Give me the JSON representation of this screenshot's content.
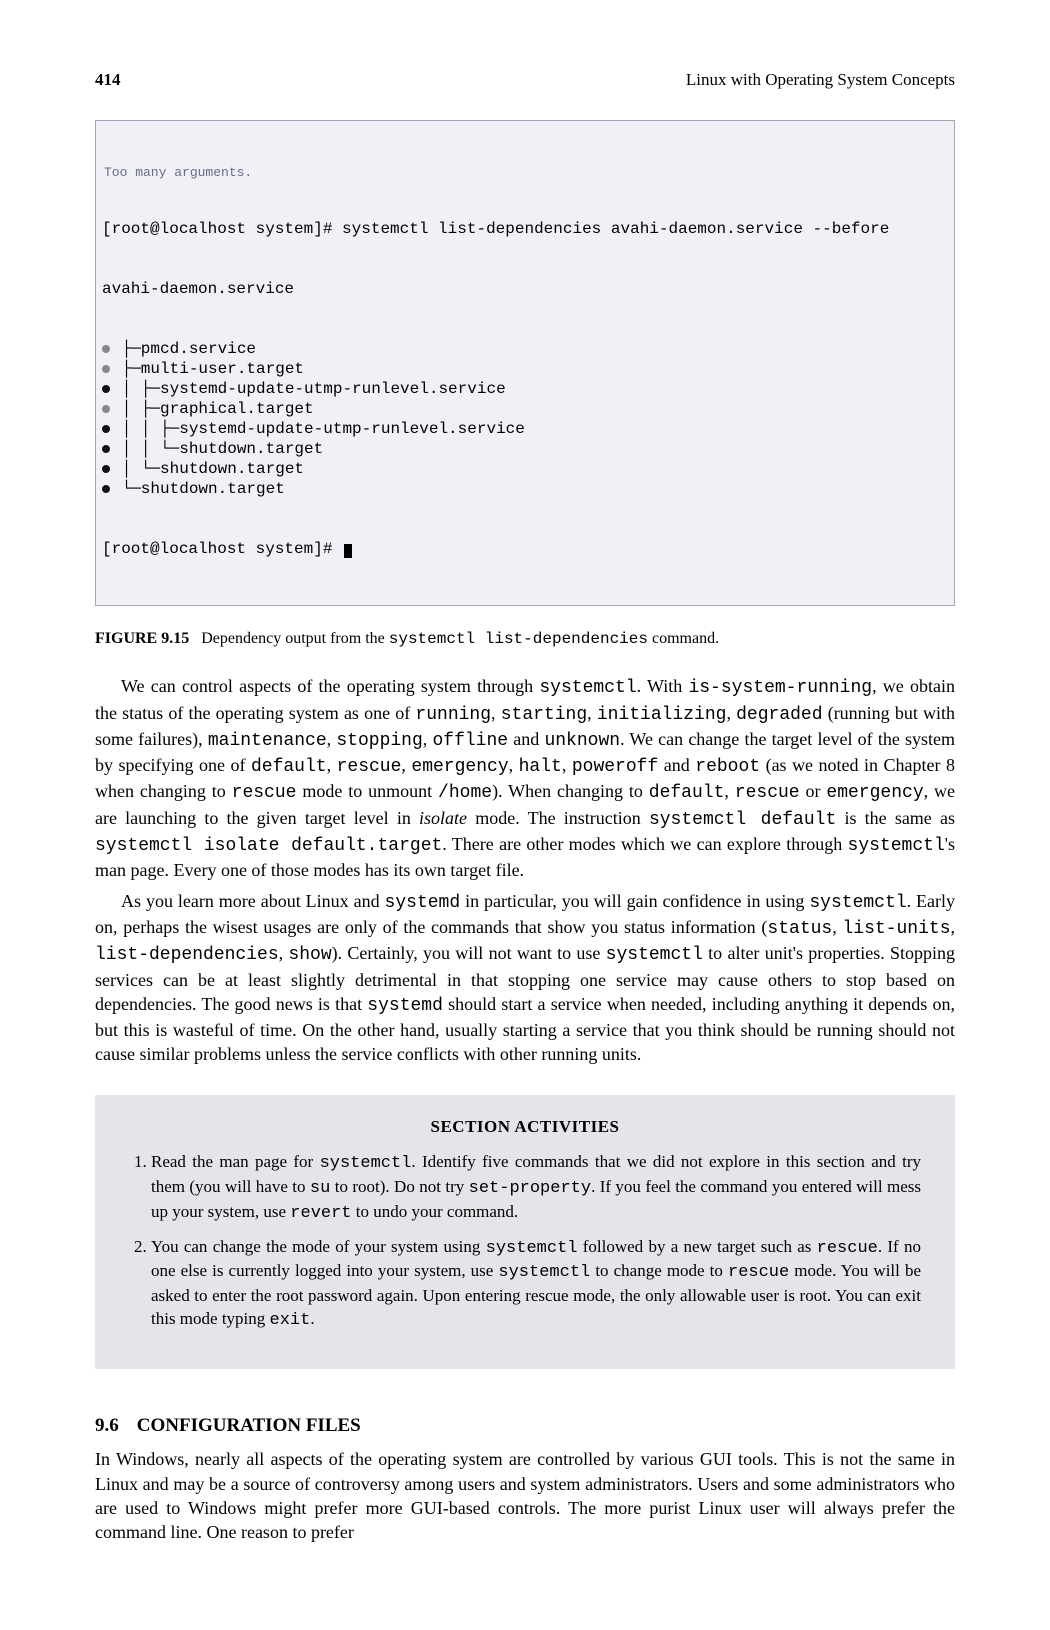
{
  "header": {
    "page_number": "414",
    "book_title": "Linux with Operating System Concepts"
  },
  "terminal": {
    "truncated_top": "Too many arguments.",
    "prompt1": "[root@localhost system]# systemctl list-dependencies avahi-daemon.service --before",
    "root_unit": "avahi-daemon.service",
    "lines": [
      {
        "bullet": "gray",
        "prefix": "├─",
        "text": "pmcd.service"
      },
      {
        "bullet": "gray",
        "prefix": "├─",
        "text": "multi-user.target"
      },
      {
        "bullet": "dark",
        "prefix": "│ ├─",
        "text": "systemd-update-utmp-runlevel.service"
      },
      {
        "bullet": "gray",
        "prefix": "│ ├─",
        "text": "graphical.target"
      },
      {
        "bullet": "dark",
        "prefix": "│ │ ├─",
        "text": "systemd-update-utmp-runlevel.service"
      },
      {
        "bullet": "dark",
        "prefix": "│ │ └─",
        "text": "shutdown.target"
      },
      {
        "bullet": "dark",
        "prefix": "│ └─",
        "text": "shutdown.target"
      },
      {
        "bullet": "dark",
        "prefix": "└─",
        "text": "shutdown.target"
      }
    ],
    "prompt2": "[root@localhost system]# "
  },
  "figure": {
    "label": "FIGURE 9.15",
    "caption_pre": "Dependency output from the ",
    "caption_code": "systemctl list-dependencies",
    "caption_post": " command."
  },
  "para1": {
    "s1a": "We can control aspects of the operating system through ",
    "c1": "systemctl",
    "s1b": ". With ",
    "c2": "is-system-running",
    "s1c": ", we obtain the status of the operating system as one of ",
    "c3": "running",
    "s1d": ", ",
    "c4": "starting",
    "s1e": ", ",
    "c5": "initializing",
    "s1f": ", ",
    "c6": "degraded",
    "s1g": " (running but with some failures), ",
    "c7": "maintenance",
    "s1h": ", ",
    "c8": "stopping",
    "s1i": ", ",
    "c9": "offline",
    "s1j": " and ",
    "c10": "unknown",
    "s1k": ". We can change the target level of the system by specifying one of ",
    "c11": "default",
    "s1l": ", ",
    "c12": "rescue",
    "s1m": ", ",
    "c13": "emergency",
    "s1n": ", ",
    "c14": "halt",
    "s1o": ", ",
    "c15": "poweroff",
    "s1p": "  and ",
    "c16": "reboot",
    "s1q": " (as we noted in Chapter 8 when changing to ",
    "c17": "rescue",
    "s1r": " mode to unmount ",
    "c18": "/home",
    "s1s": "). When changing to ",
    "c19": "default",
    "s1t": ", ",
    "c20": "rescue",
    "s1u": "  or ",
    "c21": "emergency",
    "s1v": ", we are launching to the given target level in ",
    "it1": "isolate",
    "s1w": " mode. The instruction ",
    "c22": "systemctl  default",
    "s1x": "  is the same as  ",
    "c23": "systemctl isolate default.target",
    "s1y": ". There are other modes which we can explore through  ",
    "c24": "systemctl",
    "s1z": "'s man page. Every one of those modes has its own target file."
  },
  "para2": {
    "s2a": "As you learn more about Linux and ",
    "c1": "systemd",
    "s2b": " in particular, you will gain confidence in using ",
    "c2": "systemctl",
    "s2c": ". Early on, perhaps the wisest usages are only of the commands that show you status information (",
    "c3": "status",
    "s2d": ", ",
    "c4": "list-units",
    "s2e": ", ",
    "c5": "list-dependencies",
    "s2f": ", ",
    "c6": "show",
    "s2g": "). Certainly, you will not want to use ",
    "c7": "systemctl",
    "s2h": " to alter unit's properties. Stopping services can be at least slightly detrimental in that stopping one service may cause others to stop based on dependencies. The good news is that ",
    "c8": "systemd",
    "s2i": " should start a service when needed, including anything it depends on, but this is wasteful of time. On the other hand, usually starting a service that you think should be running should not cause similar problems unless the service conflicts with other running units."
  },
  "activities": {
    "heading": "SECTION ACTIVITIES",
    "item1": {
      "a": "Read the man page for ",
      "c1": "systemctl",
      "b": ". Identify five commands that we did not explore in this section and try them (you will have to ",
      "c2": "su",
      "c": " to root). Do not try ",
      "c3": "set-property",
      "d": ". If you feel the command you entered will mess up your system, use ",
      "c4": "revert",
      "e": " to undo your command."
    },
    "item2": {
      "a": "You can change the mode of your system using ",
      "c1": "systemctl",
      "b": " followed by a new target such as ",
      "c2": "rescue",
      "c": ". If no one else is currently logged into your system, use ",
      "c3": "systemctl",
      "d": " to change mode to ",
      "c4": "rescue",
      "e": " mode. You will be asked to enter the root password again. Upon entering rescue mode, the only allowable user is root. You can exit this mode typing ",
      "c5": "exit",
      "f": "."
    }
  },
  "section": {
    "num": "9.6",
    "title": "CONFIGURATION FILES"
  },
  "para3": "In Windows, nearly all aspects of the operating system are controlled by various GUI tools. This is not the same in Linux and may be a source of controversy among users and system administrators. Users and some administrators who are used to Windows might prefer more GUI-based controls. The more purist Linux user will always prefer the command line. One reason to prefer"
}
